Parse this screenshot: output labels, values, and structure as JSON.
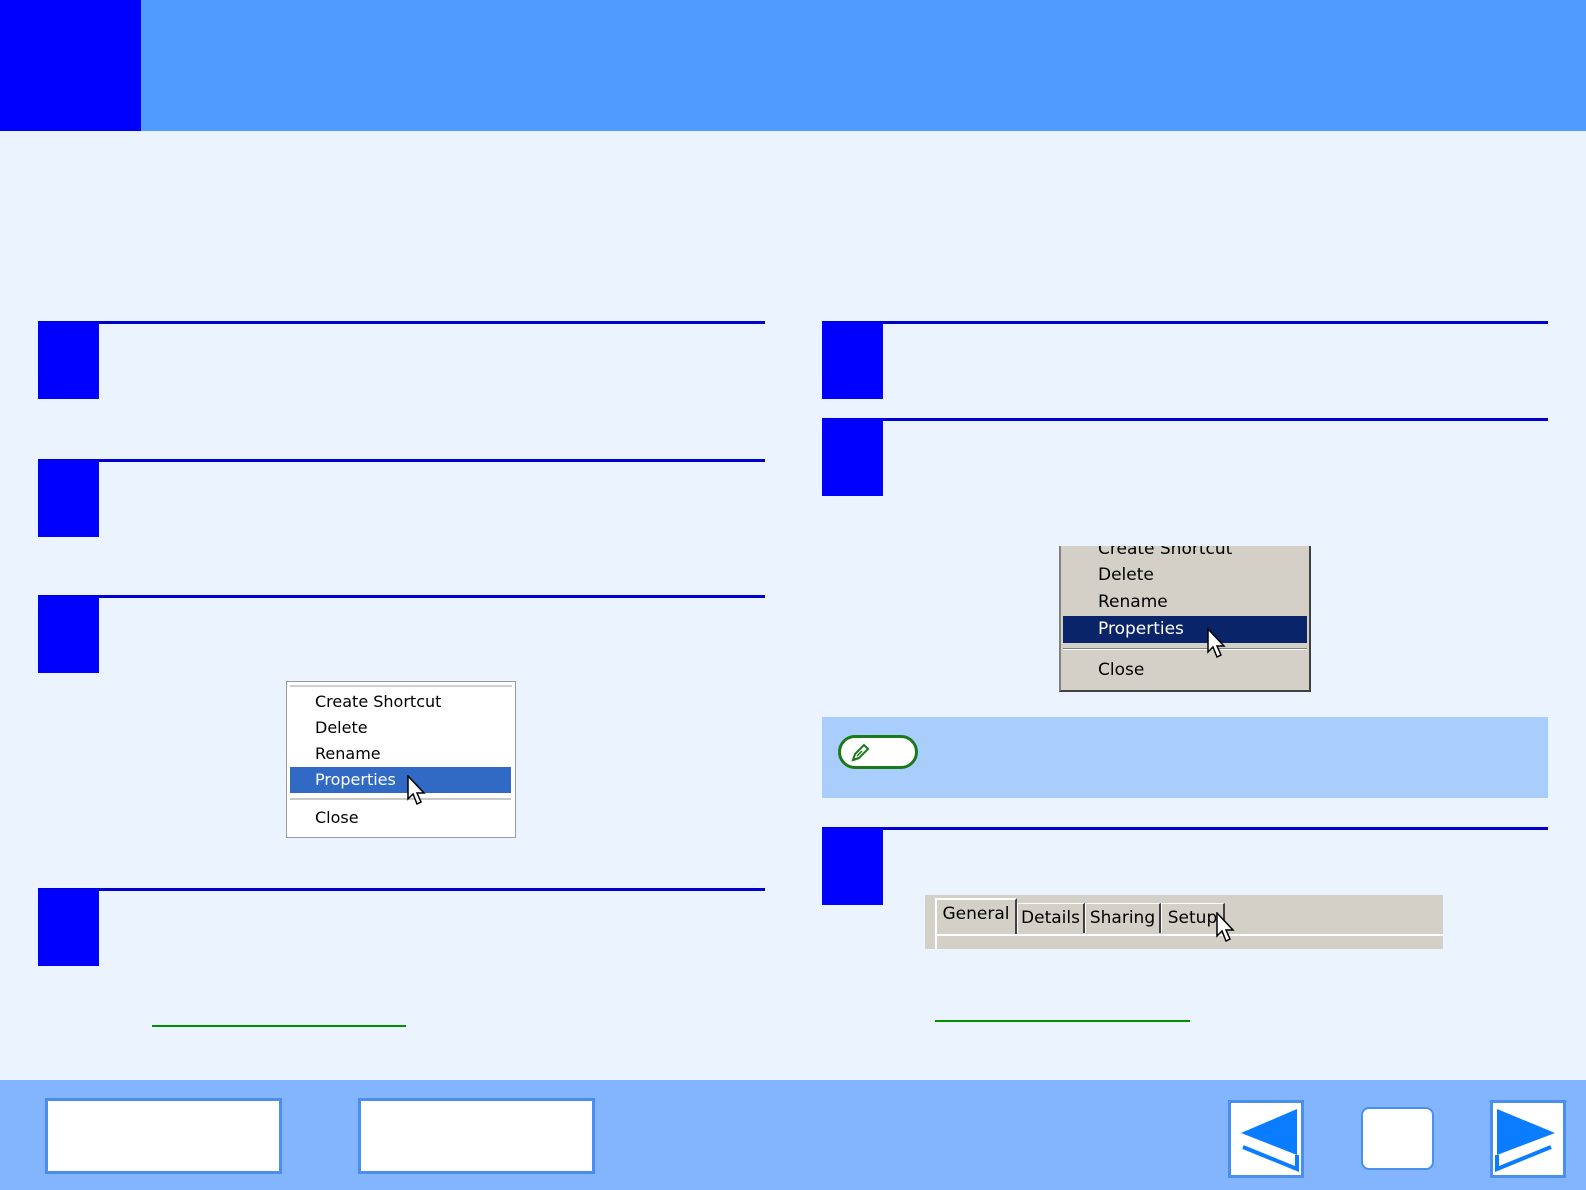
{
  "menu_xp": {
    "items": [
      "Create Shortcut",
      "Delete",
      "Rename",
      "Properties",
      "Close"
    ],
    "selected": "Properties"
  },
  "menu_classic": {
    "items": [
      "Create Shortcut",
      "Delete",
      "Rename",
      "Properties",
      "Close"
    ],
    "selected": "Properties"
  },
  "tabs": [
    "General",
    "Details",
    "Sharing",
    "Setup"
  ],
  "colors": {
    "header": "#4f9bff",
    "header_square": "#0000ff",
    "step_number": "#0000ff",
    "step_rule": "#0000cc",
    "note_box": "#a9cdfc",
    "footer": "#82b5fd",
    "link": "#009000"
  },
  "icons": {
    "note": "pencil-icon",
    "prev": "back-arrow-icon",
    "next": "forward-arrow-icon"
  }
}
